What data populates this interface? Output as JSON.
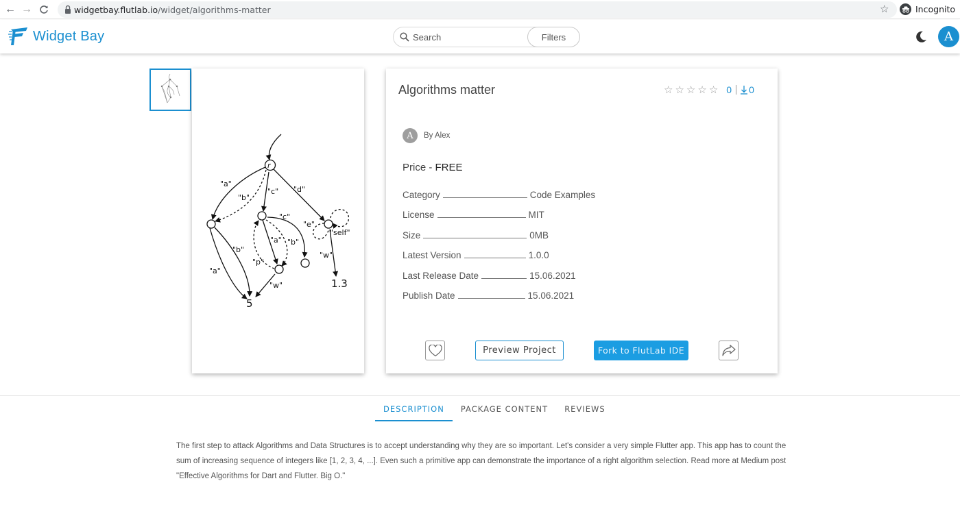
{
  "browser": {
    "url_host": "widgetbay.flutlab.io",
    "url_path": "/widget/algorithms-matter",
    "profile_label": "Incognito"
  },
  "header": {
    "logo_text": "Widget Bay",
    "search_placeholder": "Search",
    "filters_label": "Filters",
    "avatar_initial": "A",
    "brand_color": "#1b8fd0"
  },
  "gallery": {
    "diagram_labels": {
      "r": "r",
      "a1": "\"a\"",
      "b1": "\"b\"",
      "c1": "\"c\"",
      "d1": "\"d\"",
      "c2": "\"c\"",
      "e": "\"e\"",
      "self": "\"self\"",
      "b2": "\"b\"",
      "a2": "\"a\"",
      "b3": "\"b\"",
      "p": "\"p\"",
      "a3": "\"a\"",
      "w1": "\"w\"",
      "w2": "\"w\"",
      "five": "5",
      "onethree": "1.3"
    }
  },
  "widget": {
    "title": "Algorithms matter",
    "rating_count": "0",
    "download_count": "0",
    "author_initial": "A",
    "author": "By Alex",
    "price_label": "Price - ",
    "price_value": "FREE",
    "details": [
      {
        "label": "Category",
        "value": "Code Examples"
      },
      {
        "label": "License",
        "value": "MIT"
      },
      {
        "label": "Size",
        "value": "0MB"
      },
      {
        "label": "Latest Version",
        "value": "1.0.0"
      },
      {
        "label": "Last Release Date",
        "value": "15.06.2021"
      },
      {
        "label": "Publish Date",
        "value": "15.06.2021"
      }
    ],
    "preview_button": "Preview Project",
    "fork_button": "Fork to FlutLab IDE"
  },
  "tabs": [
    {
      "label": "DESCRIPTION",
      "active": true
    },
    {
      "label": "PACKAGE CONTENT",
      "active": false
    },
    {
      "label": "REVIEWS",
      "active": false
    }
  ],
  "description": "The first step to attack Algorithms and Data Structures is to accept understanding why they are so important. Let's consider a very simple Flutter app. This app has to count the sum of increasing sequence of integers like [1, 2, 3, 4, ...]. Even such a primitive app can demonstrate the importance of a right algorithm selection. Read more at Medium post \"Effective Algorithms for Dart and Flutter. Big O.\""
}
